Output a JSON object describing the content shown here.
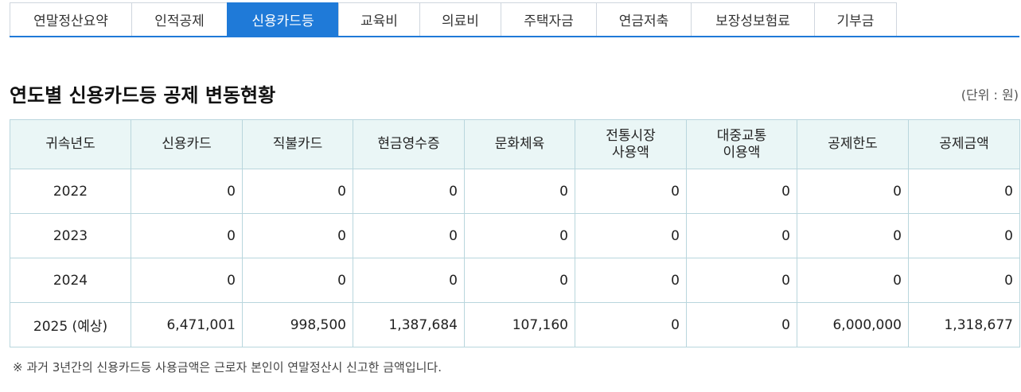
{
  "tabs": [
    {
      "label": "연말정산요약",
      "active": false
    },
    {
      "label": "인적공제",
      "active": false
    },
    {
      "label": "신용카드등",
      "active": true
    },
    {
      "label": "교육비",
      "active": false
    },
    {
      "label": "의료비",
      "active": false
    },
    {
      "label": "주택자금",
      "active": false
    },
    {
      "label": "연금저축",
      "active": false
    },
    {
      "label": "보장성보험료",
      "active": false
    },
    {
      "label": "기부금",
      "active": false
    }
  ],
  "section": {
    "title": "연도별 신용카드등 공제 변동현황",
    "unit": "(단위 : 원)"
  },
  "table": {
    "headers": [
      {
        "line1": "귀속년도",
        "line2": ""
      },
      {
        "line1": "신용카드",
        "line2": ""
      },
      {
        "line1": "직불카드",
        "line2": ""
      },
      {
        "line1": "현금영수증",
        "line2": ""
      },
      {
        "line1": "문화체육",
        "line2": ""
      },
      {
        "line1": "전통시장",
        "line2": "사용액"
      },
      {
        "line1": "대중교통",
        "line2": "이용액"
      },
      {
        "line1": "공제한도",
        "line2": ""
      },
      {
        "line1": "공제금액",
        "line2": ""
      }
    ],
    "rows": [
      [
        "2022",
        "0",
        "0",
        "0",
        "0",
        "0",
        "0",
        "0",
        "0"
      ],
      [
        "2023",
        "0",
        "0",
        "0",
        "0",
        "0",
        "0",
        "0",
        "0"
      ],
      [
        "2024",
        "0",
        "0",
        "0",
        "0",
        "0",
        "0",
        "0",
        "0"
      ],
      [
        "2025 (예상)",
        "6,471,001",
        "998,500",
        "1,387,684",
        "107,160",
        "0",
        "0",
        "6,000,000",
        "1,318,677"
      ]
    ]
  },
  "note": "※ 과거 3년간의 신용카드등 사용금액은 근로자 본인이 연말정산시 신고한 금액입니다.",
  "colors": {
    "accent": "#1f7ad8",
    "header_bg": "#eaf6f6",
    "border": "#b9d6dd"
  }
}
